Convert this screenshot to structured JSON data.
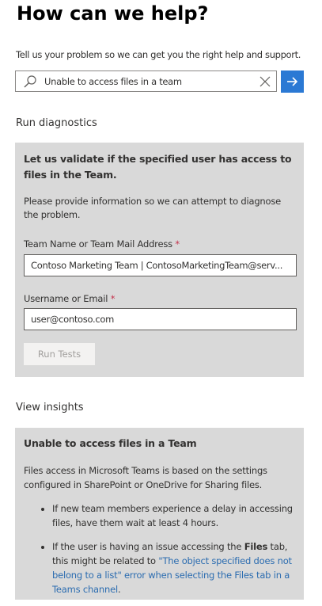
{
  "header": {
    "title": "How can we help?",
    "subtitle": "Tell us your problem so we can get you the right help and support."
  },
  "search": {
    "value": "Unable to access files in a team",
    "icons": {
      "search": "search-icon",
      "clear": "close-icon",
      "submit": "arrow-right-icon"
    },
    "submit_color": "#2b79d4"
  },
  "diagnostics": {
    "heading": "Run diagnostics",
    "panel_title": "Let us validate if the specified user has access to files in the Team.",
    "panel_desc": "Please provide information so we can attempt to diagnose the problem.",
    "team_field": {
      "label": "Team Name or Team Mail Address",
      "required_mark": "*",
      "value": "Contoso Marketing Team | ContosoMarketingTeam@serv..."
    },
    "user_field": {
      "label": "Username or Email",
      "required_mark": "*",
      "value": "user@contoso.com"
    },
    "run_button": "Run Tests"
  },
  "insights": {
    "heading": "View insights",
    "panel_title": "Unable to access files in a Team",
    "panel_desc": "Files access in Microsoft Teams is based on the settings configured in SharePoint or OneDrive for Sharing files.",
    "bullet1": "If new team members experience a delay in accessing files, have them wait at least 4 hours.",
    "bullet2_pre": "If the user is having an issue accessing the ",
    "bullet2_bold": "Files",
    "bullet2_mid": " tab, this might be related to ",
    "bullet2_link": "\"The object specified does not belong to a list\" error when selecting the Files tab in a Teams channel",
    "bullet2_end": "."
  },
  "colors": {
    "panel_bg": "#d9d9d9",
    "required": "#c4314b",
    "link": "#2b6cb0"
  }
}
